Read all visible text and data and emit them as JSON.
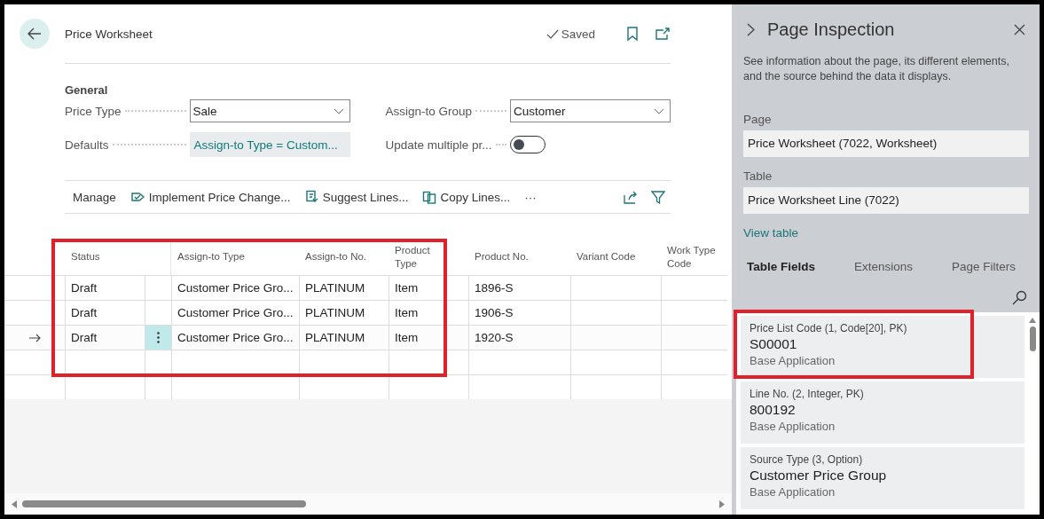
{
  "page": {
    "title": "Price Worksheet",
    "save_status": "Saved"
  },
  "general": {
    "heading": "General",
    "fields": [
      {
        "kind": "select",
        "label": "Price Type",
        "value": "Sale"
      },
      {
        "kind": "select",
        "label": "Assign-to Group",
        "value": "Customer"
      },
      {
        "kind": "link",
        "label": "Defaults",
        "value": "Assign-to Type = Custom..."
      },
      {
        "kind": "toggle",
        "label": "Update multiple pr...",
        "on": false
      }
    ]
  },
  "actions": [
    "Manage",
    "Implement Price Change...",
    "Suggest Lines...",
    "Copy Lines...",
    "···"
  ],
  "table": {
    "highlighted": true,
    "columns": [
      "Status",
      "",
      "Assign-to Type",
      "Assign-to No.",
      "Product Type",
      "Product No.",
      "Variant Code",
      "Work Type Code"
    ],
    "rows": [
      {
        "selected": false,
        "cells": [
          "Draft",
          "",
          "Customer Price Gro...",
          "PLATINUM",
          "Item",
          "1896-S",
          "",
          ""
        ]
      },
      {
        "selected": false,
        "cells": [
          "Draft",
          "",
          "Customer Price Gro...",
          "PLATINUM",
          "Item",
          "1906-S",
          "",
          ""
        ]
      },
      {
        "selected": true,
        "cells": [
          "Draft",
          "",
          "Customer Price Gro...",
          "PLATINUM",
          "Item",
          "1920-S",
          "",
          ""
        ]
      },
      {
        "selected": false,
        "cells": [
          "",
          "",
          "",
          "",
          "",
          "",
          "",
          ""
        ]
      },
      {
        "selected": false,
        "cells": [
          "",
          "",
          "",
          "",
          "",
          "",
          "",
          ""
        ]
      }
    ]
  },
  "inspection": {
    "title": "Page Inspection",
    "description": "See information about the page, its different elements, and the source behind the data it displays.",
    "page_label": "Page",
    "page_value": "Price Worksheet (7022, Worksheet)",
    "table_label": "Table",
    "table_value": "Price Worksheet Line (7022)",
    "view_link": "View table",
    "tabs": [
      {
        "label": "Table Fields",
        "selected": true
      },
      {
        "label": "Extensions",
        "selected": false
      },
      {
        "label": "Page Filters",
        "selected": false
      }
    ],
    "fields": [
      {
        "caption": "Price List Code (1, Code[20], PK)",
        "value": "S00001",
        "source": "Base Application",
        "highlighted": true
      },
      {
        "caption": "Line No. (2, Integer, PK)",
        "value": "800192",
        "source": "Base Application",
        "highlighted": false
      },
      {
        "caption": "Source Type (3, Option)",
        "value": "Customer Price Group",
        "source": "Base Application",
        "highlighted": false
      }
    ]
  }
}
